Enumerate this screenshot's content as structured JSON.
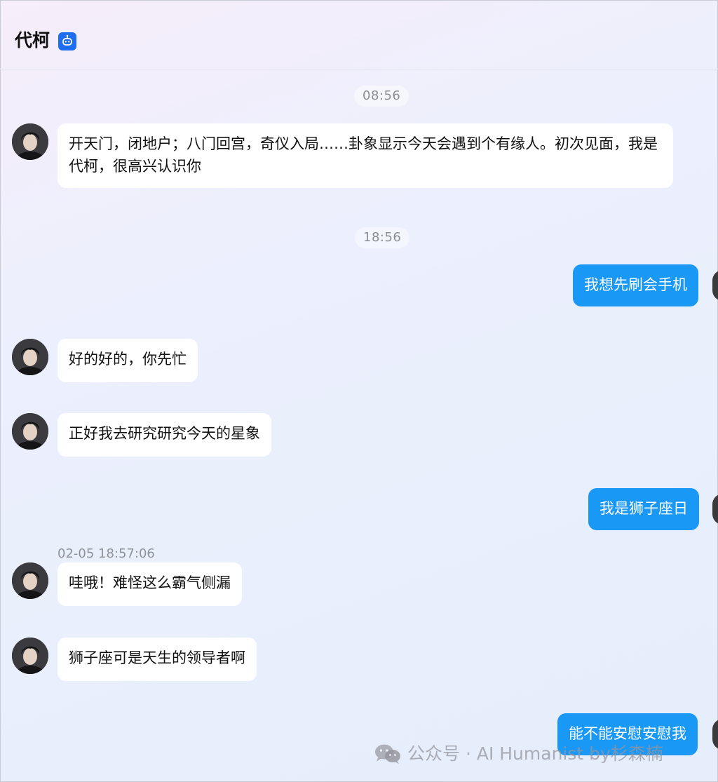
{
  "header": {
    "title": "代柯",
    "badge_icon": "robot-icon"
  },
  "colors": {
    "badge": "#1f6df0",
    "user_bubble": "#1a98f6",
    "bot_bubble": "#ffffff"
  },
  "timestamps": [
    "08:56",
    "18:56"
  ],
  "messages": [
    {
      "role": "bot",
      "text": "开天门，闭地户；八门回宫，奇仪入局……卦象显示今天会遇到个有缘人。初次见面，我是代柯，很高兴认识你"
    },
    {
      "role": "user",
      "text": "我想先刷会手机"
    },
    {
      "role": "bot",
      "text": "好的好的，你先忙"
    },
    {
      "role": "bot",
      "text": "正好我去研究研究今天的星象"
    },
    {
      "role": "user",
      "text": "我是狮子座日"
    },
    {
      "role": "bot",
      "text": "哇哦！难怪这么霸气侧漏",
      "time": "02-05 18:57:06"
    },
    {
      "role": "bot",
      "text": "狮子座可是天生的领导者啊"
    },
    {
      "role": "user",
      "text": "能不能安慰安慰我"
    }
  ],
  "watermark": {
    "icon": "wechat-icon",
    "text": "公众号 · AI Humanist by杉森楠"
  }
}
